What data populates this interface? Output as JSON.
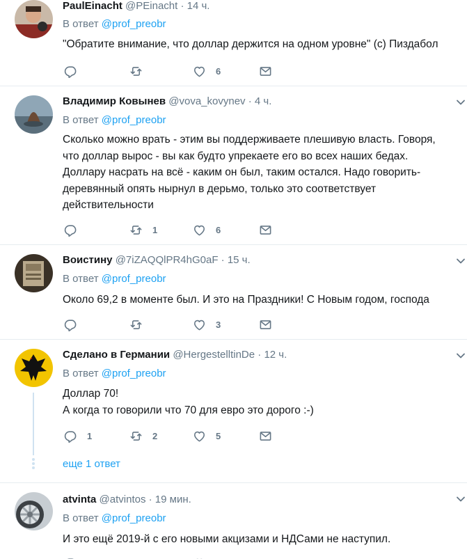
{
  "tweets": [
    {
      "name": "PaulEinacht",
      "handle": "@PEinacht",
      "time": "14 ч.",
      "reply_label": "В ответ",
      "reply_to": "@prof_preobr",
      "text": "\"Обратите внимание, что доллар держится на одном уровне\" (с) Пиздабол",
      "reply_count": "",
      "retweet_count": "",
      "like_count": "6",
      "avatar_icon": "user-avatar-photo"
    },
    {
      "name": "Владимир Ковынев",
      "handle": "@vova_kovynev",
      "time": "4 ч.",
      "reply_label": "В ответ",
      "reply_to": "@prof_preobr",
      "text_lines": [
        "Сколько можно врать - этим вы поддерживаете плешивую власть. Говоря,",
        "что доллар вырос - вы как будто упрекаете его во всех наших бедах.",
        "Доллару насрать на всё - каким он был, таким остался. Надо говорить-",
        "деревянный опять нырнул в дерьмо, только это соответствует",
        "действительности"
      ],
      "reply_count": "",
      "retweet_count": "1",
      "like_count": "6",
      "avatar_icon": "user-avatar-photo"
    },
    {
      "name": "Воистину",
      "handle": "@7iZAQQlPR4hG0aF",
      "time": "15 ч.",
      "reply_label": "В ответ",
      "reply_to": "@prof_preobr",
      "text": "Около 69,2 в моменте был. И это на Праздники! С Новым годом, господа",
      "reply_count": "",
      "retweet_count": "",
      "like_count": "3",
      "avatar_icon": "user-avatar-photo"
    },
    {
      "name": "Сделано в Германии",
      "handle": "@HergestelltinDe",
      "time": "12 ч.",
      "reply_label": "В ответ",
      "reply_to": "@prof_preobr",
      "text_lines": [
        "Доллар 70!",
        "А когда то говорили что 70 для евро это дорого :-)"
      ],
      "reply_count": "1",
      "retweet_count": "2",
      "like_count": "5",
      "more_replies": "еще 1 ответ",
      "avatar_icon": "eagle-avatar"
    },
    {
      "name": "atvinta",
      "handle": "@atvintos",
      "time": "19 мин.",
      "reply_label": "В ответ",
      "reply_to": "@prof_preobr",
      "text": "И это ещё 2019-й с его новыми акцизами и НДСами не наступил.",
      "avatar_icon": "car-wheel-avatar"
    }
  ],
  "colors": {
    "link": "#1da1f2",
    "secondary": "#657786",
    "text": "#14171a",
    "divider": "#e6ecf0"
  }
}
